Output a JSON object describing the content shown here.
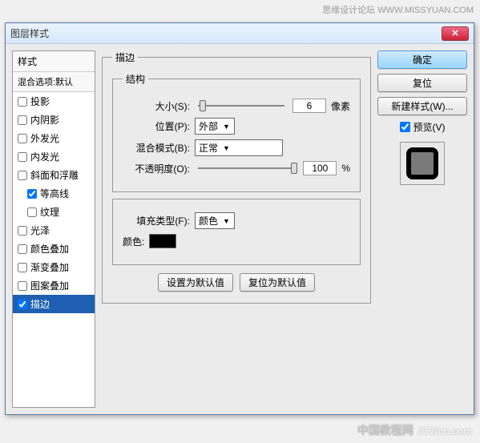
{
  "watermark": {
    "top": "思缘设计论坛  WWW.MISSYUAN.COM",
    "bottom_cn": "中国教程网",
    "bottom_en": "JCWcn.com"
  },
  "dialog": {
    "title": "图层样式"
  },
  "styles": {
    "header": "样式",
    "subheader": "混合选项:默认",
    "items": [
      {
        "label": "投影",
        "checked": false
      },
      {
        "label": "内阴影",
        "checked": false
      },
      {
        "label": "外发光",
        "checked": false
      },
      {
        "label": "内发光",
        "checked": false
      },
      {
        "label": "斜面和浮雕",
        "checked": false
      },
      {
        "label": "等高线",
        "checked": true,
        "indent": true
      },
      {
        "label": "纹理",
        "checked": false,
        "indent": true
      },
      {
        "label": "光泽",
        "checked": false
      },
      {
        "label": "颜色叠加",
        "checked": false
      },
      {
        "label": "渐变叠加",
        "checked": false
      },
      {
        "label": "图案叠加",
        "checked": false
      },
      {
        "label": "描边",
        "checked": true,
        "selected": true
      }
    ]
  },
  "main": {
    "title": "描边",
    "structure": {
      "legend": "结构",
      "size_label": "大小(S):",
      "size_value": "6",
      "size_unit": "像素",
      "position_label": "位置(P):",
      "position_value": "外部",
      "blend_label": "混合模式(B):",
      "blend_value": "正常",
      "opacity_label": "不透明度(O):",
      "opacity_value": "100",
      "opacity_unit": "%"
    },
    "fill": {
      "type_label": "填充类型(F):",
      "type_value": "颜色",
      "color_label": "颜色:"
    },
    "buttons": {
      "set_default": "设置为默认值",
      "reset_default": "复位为默认值"
    }
  },
  "right": {
    "ok": "确定",
    "cancel": "复位",
    "new_style": "新建样式(W)...",
    "preview_label": "预览(V)"
  }
}
